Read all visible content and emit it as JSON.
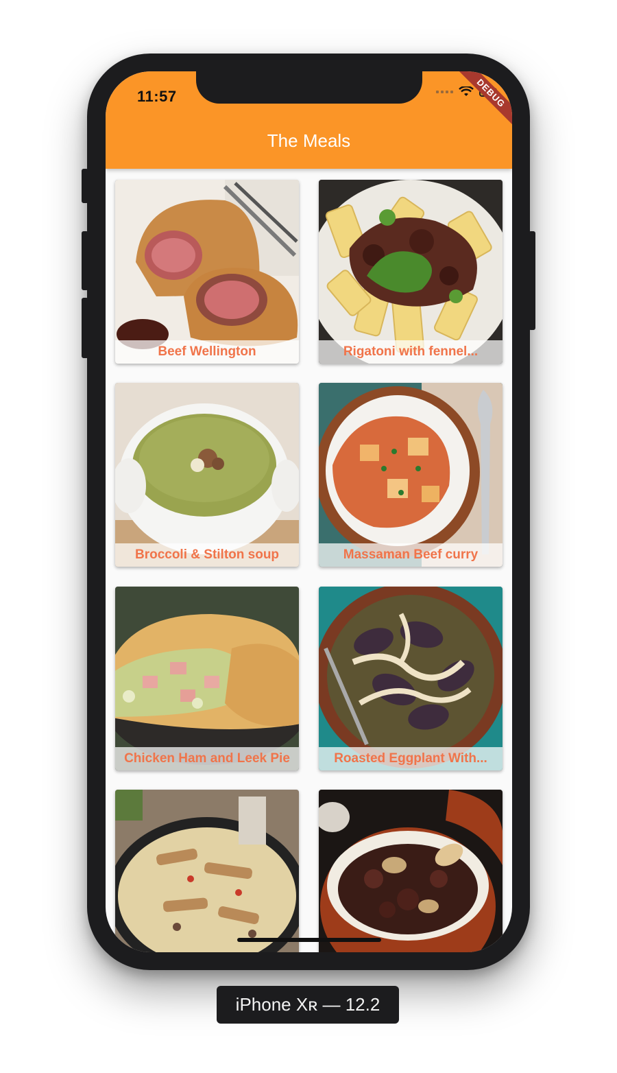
{
  "status_bar": {
    "time": "11:57",
    "debug_banner": "DEBUG"
  },
  "app_bar": {
    "title": "The Meals"
  },
  "meals": [
    {
      "name": "Beef Wellington",
      "image": "beef-wellington-photo"
    },
    {
      "name": "Rigatoni with fennel...",
      "image": "rigatoni-photo"
    },
    {
      "name": "Broccoli & Stilton soup",
      "image": "broccoli-soup-photo"
    },
    {
      "name": "Massaman Beef curry",
      "image": "massaman-curry-photo"
    },
    {
      "name": "Chicken Ham and Leek Pie",
      "image": "chicken-pie-photo"
    },
    {
      "name": "Roasted Eggplant With...",
      "image": "roasted-eggplant-photo"
    },
    {
      "name": "",
      "image": "chicken-pasta-photo"
    },
    {
      "name": "",
      "image": "beef-stew-photo"
    }
  ],
  "device_label": "iPhone Xʀ — 12.2",
  "colors": {
    "app_bar": "#fb9527",
    "caption_text": "#f0744a",
    "debug_banner": "#a8392e"
  }
}
